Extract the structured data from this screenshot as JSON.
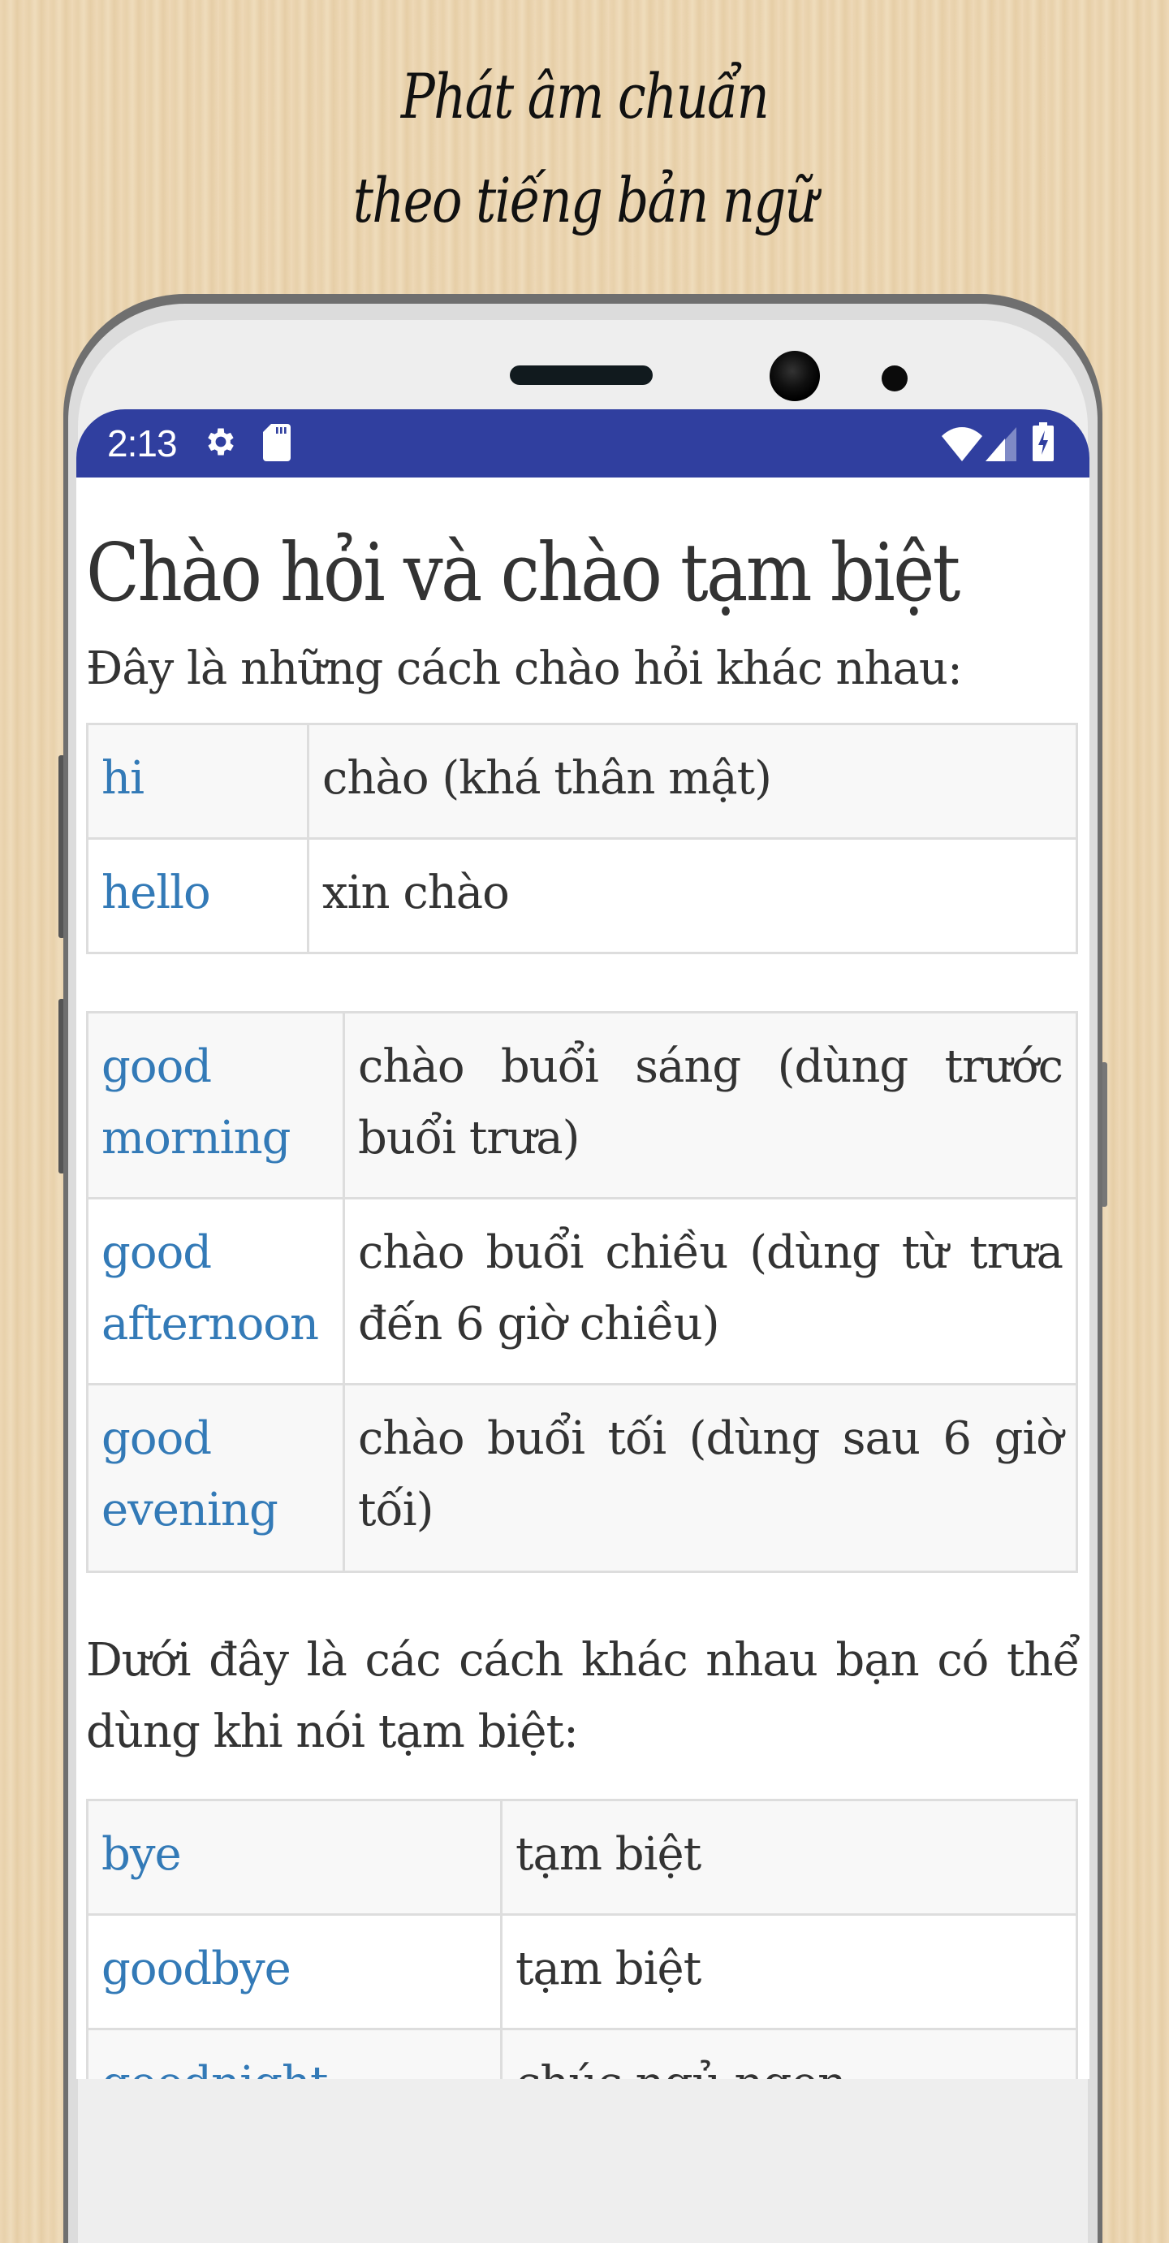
{
  "promo": {
    "line1": "Phát âm chuẩn",
    "line2": "theo tiếng bản ngữ"
  },
  "statusbar": {
    "time": "2:13",
    "left_icons": [
      "settings-icon",
      "sd-card-icon"
    ],
    "right_icons": [
      "wifi-icon",
      "signal-icon",
      "battery-charging-icon"
    ],
    "color": "#303f9f"
  },
  "page": {
    "title": "Chào hỏi và chào tạm biệt",
    "intro": "Đây là những cách chào hỏi khác nhau:",
    "table1": [
      {
        "en": "hi",
        "vi": "chào (khá thân mật)"
      },
      {
        "en": "hello",
        "vi": "xin chào"
      }
    ],
    "table2": [
      {
        "en": "good morning",
        "vi": "chào buổi sáng (dùng trước buổi trưa)"
      },
      {
        "en": "good afternoon",
        "vi": "chào buổi chiều (dùng từ trưa đến 6 giờ chiều)"
      },
      {
        "en": "good evening",
        "vi": "chào buổi tối (dùng sau 6 giờ tối)"
      }
    ],
    "goodbye_intro": "Dưới đây là các cách khác nhau bạn có thể dùng khi nói tạm biệt:",
    "table3": [
      {
        "en": "bye",
        "vi": "tạm biệt"
      },
      {
        "en": "goodbye",
        "vi": "tạm biệt"
      },
      {
        "en": "goodnight",
        "vi": "chúc ngủ ngon"
      }
    ],
    "link_color": "#337ab7",
    "text_color": "#333333"
  }
}
